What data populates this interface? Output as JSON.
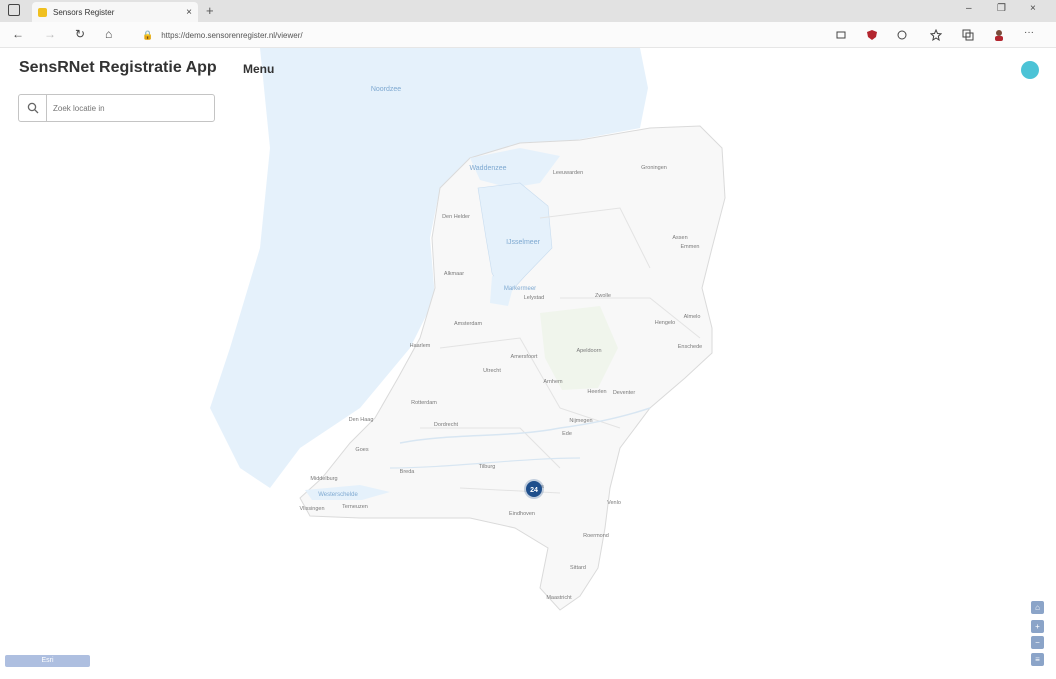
{
  "browser": {
    "tab_title": "Sensors Register",
    "url": "https://demo.sensorenregister.nl/viewer/",
    "new_tab": "+",
    "tab_close": "×",
    "window_controls": {
      "minimize": "–",
      "restore": "❐",
      "close": "×"
    }
  },
  "header": {
    "app_title": "SensRNet Registratie App",
    "menu_label": "Menu"
  },
  "search": {
    "placeholder": "Zoek locatie in"
  },
  "map": {
    "water_labels": [
      "Noordzee",
      "Waddenzee",
      "IJsselmeer",
      "Markermeer",
      "Westerschelde"
    ],
    "cities": [
      "Den Helder",
      "Leeuwarden",
      "Groningen",
      "Emmen",
      "Zwolle",
      "Lelystad",
      "Alkmaar",
      "Haarlem",
      "Amsterdam",
      "Den Haag",
      "Rotterdam",
      "Utrecht",
      "Amersfoort",
      "Apeldoorn",
      "Arnhem",
      "Nijmegen",
      "Enschede",
      "Hengelo",
      "Dordrecht",
      "Breda",
      "Tilburg",
      "Eindhoven",
      "Venlo",
      "Roermond",
      "Maastricht",
      "Middelburg",
      "Vlissingen",
      "Sittard",
      "Heerlen",
      "Goes",
      "Assen",
      "Deventer",
      "Almelo",
      "Terneuzen",
      "Oss",
      "Ede"
    ],
    "cluster_count": "24",
    "colors": {
      "land": "#f8f8f8",
      "sea": "#e5f1fb",
      "cluster": "#1f4f8c",
      "accent": "#4cc3d6"
    }
  },
  "controls": {
    "zoom_in": "+",
    "zoom_out": "−",
    "home": "⌂",
    "attribution": "Esri"
  }
}
